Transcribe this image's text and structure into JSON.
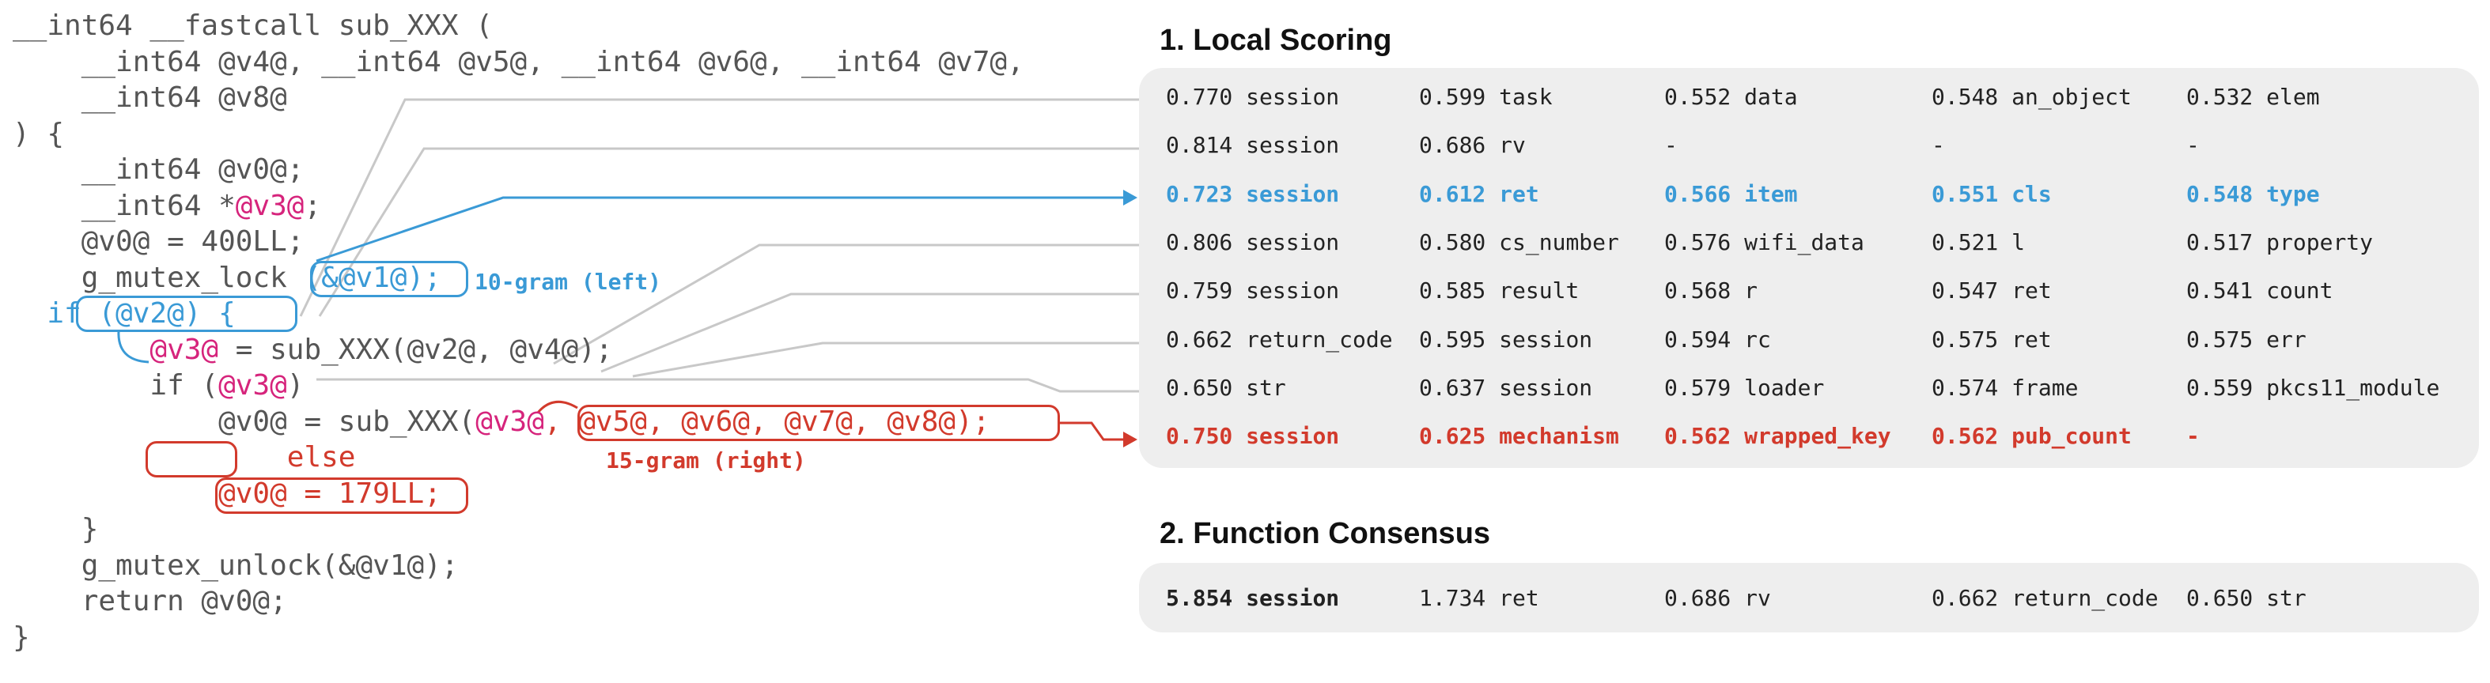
{
  "code": {
    "lines": [
      {
        "segments": [
          {
            "text": "__int64 __fastcall sub_XXX (",
            "style": "plain"
          }
        ]
      },
      {
        "segments": [
          {
            "text": "    __int64 @v4@, __int64 @v5@, __int64 @v6@, __int64 @v7@,",
            "style": "plain"
          }
        ]
      },
      {
        "segments": [
          {
            "text": "    __int64 @v8@",
            "style": "plain"
          }
        ]
      },
      {
        "segments": [
          {
            "text": ") {",
            "style": "plain"
          }
        ]
      },
      {
        "segments": [
          {
            "text": "    __int64 @v0@;",
            "style": "plain"
          }
        ]
      },
      {
        "segments": [
          {
            "text": "    __int64 *",
            "style": "plain"
          },
          {
            "text": "@v3@",
            "style": "var"
          },
          {
            "text": ";",
            "style": "plain"
          }
        ]
      },
      {
        "segments": [
          {
            "text": "    @v0@ = 400LL;",
            "style": "plain"
          }
        ]
      },
      {
        "segments": [
          {
            "text": "    g_mutex_lock ",
            "style": "plain"
          },
          {
            "text": "(&@v1@);",
            "style": "blue"
          }
        ]
      },
      {
        "segments": [
          {
            "text": "if (@v2@) {",
            "style": "blue"
          }
        ]
      },
      {
        "segments": [
          {
            "text": "        ",
            "style": "plain"
          },
          {
            "text": "@v3@",
            "style": "var"
          },
          {
            "text": " = sub_XXX(@v2@, @v4@);",
            "style": "plain"
          }
        ]
      },
      {
        "segments": [
          {
            "text": "        if (",
            "style": "plain"
          },
          {
            "text": "@v3@",
            "style": "var"
          },
          {
            "text": ")",
            "style": "plain"
          }
        ]
      },
      {
        "segments": [
          {
            "text": "            @v0@ = sub_XXX(",
            "style": "plain"
          },
          {
            "text": "@v3@",
            "style": "var"
          },
          {
            "text": ", @v5@, @v6@, @v7@, @v8@);",
            "style": "red"
          }
        ]
      },
      {
        "segments": [
          {
            "text": "        else",
            "style": "red"
          }
        ]
      },
      {
        "segments": [
          {
            "text": "            @v0@ = 179LL;",
            "style": "red"
          }
        ]
      },
      {
        "segments": [
          {
            "text": "    }",
            "style": "plain"
          }
        ]
      },
      {
        "segments": [
          {
            "text": "    g_mutex_unlock(&@v1@);",
            "style": "plain"
          }
        ]
      },
      {
        "segments": [
          {
            "text": "    return @v0@;",
            "style": "plain"
          }
        ]
      },
      {
        "segments": [
          {
            "text": "}",
            "style": "plain"
          }
        ]
      }
    ],
    "label_left": "10-gram (left)",
    "label_right": "15-gram (right)"
  },
  "local_scoring": {
    "title": "1. Local Scoring",
    "rows": [
      {
        "highlight": "none",
        "cells": [
          [
            "0.770",
            "session"
          ],
          [
            "0.599",
            "task"
          ],
          [
            "0.552",
            "data"
          ],
          [
            "0.548",
            "an_object"
          ],
          [
            "0.532",
            "elem"
          ]
        ]
      },
      {
        "highlight": "none",
        "cells": [
          [
            "0.814",
            "session"
          ],
          [
            "0.686",
            "rv"
          ],
          [
            "-",
            ""
          ],
          [
            "-",
            ""
          ],
          [
            "-",
            ""
          ]
        ]
      },
      {
        "highlight": "blue",
        "cells": [
          [
            "0.723",
            "session"
          ],
          [
            "0.612",
            "ret"
          ],
          [
            "0.566",
            "item"
          ],
          [
            "0.551",
            "cls"
          ],
          [
            "0.548",
            "type"
          ]
        ]
      },
      {
        "highlight": "none",
        "cells": [
          [
            "0.806",
            "session"
          ],
          [
            "0.580",
            "cs_number"
          ],
          [
            "0.576",
            "wifi_data"
          ],
          [
            "0.521",
            "l"
          ],
          [
            "0.517",
            "property"
          ]
        ]
      },
      {
        "highlight": "none",
        "cells": [
          [
            "0.759",
            "session"
          ],
          [
            "0.585",
            "result"
          ],
          [
            "0.568",
            "r"
          ],
          [
            "0.547",
            "ret"
          ],
          [
            "0.541",
            "count"
          ]
        ]
      },
      {
        "highlight": "none",
        "cells": [
          [
            "0.662",
            "return_code"
          ],
          [
            "0.595",
            "session"
          ],
          [
            "0.594",
            "rc"
          ],
          [
            "0.575",
            "ret"
          ],
          [
            "0.575",
            "err"
          ]
        ]
      },
      {
        "highlight": "none",
        "cells": [
          [
            "0.650",
            "str"
          ],
          [
            "0.637",
            "session"
          ],
          [
            "0.579",
            "loader"
          ],
          [
            "0.574",
            "frame"
          ],
          [
            "0.559",
            "pkcs11_module"
          ]
        ]
      },
      {
        "highlight": "red",
        "cells": [
          [
            "0.750",
            "session"
          ],
          [
            "0.625",
            "mechanism"
          ],
          [
            "0.562",
            "wrapped_key"
          ],
          [
            "0.562",
            "pub_count"
          ],
          [
            "-",
            ""
          ]
        ]
      }
    ]
  },
  "function_consensus": {
    "title": "2. Function Consensus",
    "cells": [
      [
        "5.854",
        "session"
      ],
      [
        "1.734",
        "ret"
      ],
      [
        "0.686",
        "rv"
      ],
      [
        "0.662",
        "return_code"
      ],
      [
        "0.650",
        "str"
      ]
    ]
  },
  "colors": {
    "blue": "#3a9ad6",
    "red": "#d23a2c",
    "var": "#d6247c",
    "gray_line": "#c8c8c8",
    "panel": "#eeeeee"
  }
}
